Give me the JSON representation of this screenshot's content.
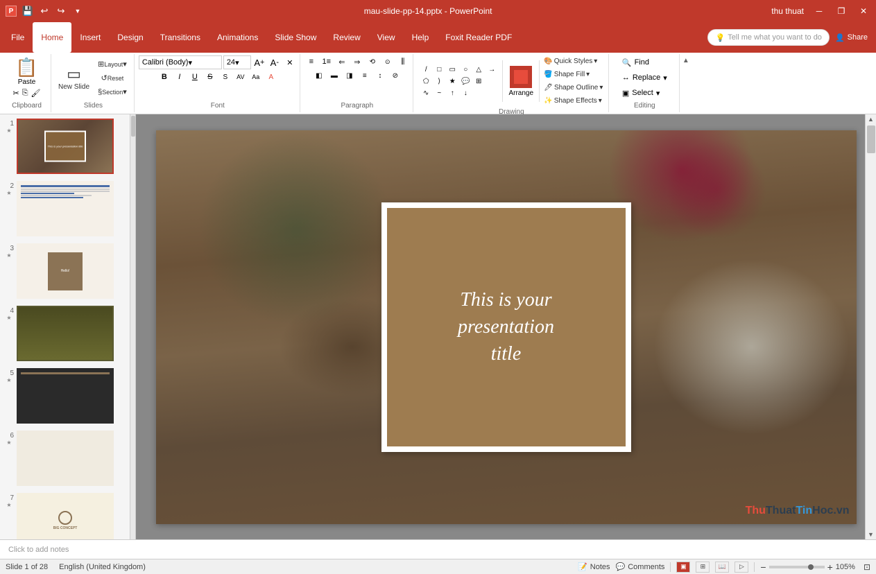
{
  "titlebar": {
    "title": "mau-slide-pp-14.pptx - PowerPoint",
    "user": "thu thuat",
    "save_icon": "💾",
    "undo_icon": "↩",
    "redo_icon": "↪",
    "customize_icon": "▼",
    "minimize_icon": "─",
    "restore_icon": "❐",
    "close_icon": "✕"
  },
  "menubar": {
    "items": [
      "File",
      "Home",
      "Insert",
      "Design",
      "Transitions",
      "Animations",
      "Slide Show",
      "Review",
      "View",
      "Help",
      "Foxit Reader PDF"
    ]
  },
  "ribbon": {
    "clipboard_label": "Clipboard",
    "slides_label": "Slides",
    "font_label": "Font",
    "paragraph_label": "Paragraph",
    "drawing_label": "Drawing",
    "editing_label": "Editing",
    "paste_label": "Paste",
    "new_slide_label": "New Slide",
    "layout_label": "Layout",
    "reset_label": "Reset",
    "section_label": "Section",
    "font_name": "Calibri (Body)",
    "font_size": "24",
    "bold": "B",
    "italic": "I",
    "underline": "U",
    "strikethrough": "S",
    "find_label": "Find",
    "replace_label": "Replace",
    "select_label": "Select",
    "arrange_label": "Arrange",
    "quick_styles_label": "Quick Styles",
    "shape_fill_label": "Shape Fill",
    "shape_outline_label": "Shape Outline",
    "shape_effects_label": "Shape Effects",
    "tell_me": "Tell me what you want to do",
    "share_label": "Share"
  },
  "slides": [
    {
      "num": "1",
      "star": "★",
      "type": "main"
    },
    {
      "num": "2",
      "star": "★",
      "type": "list"
    },
    {
      "num": "3",
      "star": "★",
      "type": "card"
    },
    {
      "num": "4",
      "star": "★",
      "type": "yellow"
    },
    {
      "num": "5",
      "star": "★",
      "type": "dark"
    },
    {
      "num": "6",
      "star": "★",
      "type": "light"
    },
    {
      "num": "7",
      "star": "★",
      "type": "concept"
    }
  ],
  "main_slide": {
    "title_line1": "This is your",
    "title_line2": "presentation",
    "title_line3": "title"
  },
  "statusbar": {
    "slide_info": "Slide 1 of 28",
    "language": "English (United Kingdom)",
    "notes_label": "Notes",
    "comments_label": "Comments",
    "zoom": "105%",
    "add_notes": "Click to add notes"
  },
  "watermark": {
    "text": "ThuThuatTinHoc.vn"
  }
}
